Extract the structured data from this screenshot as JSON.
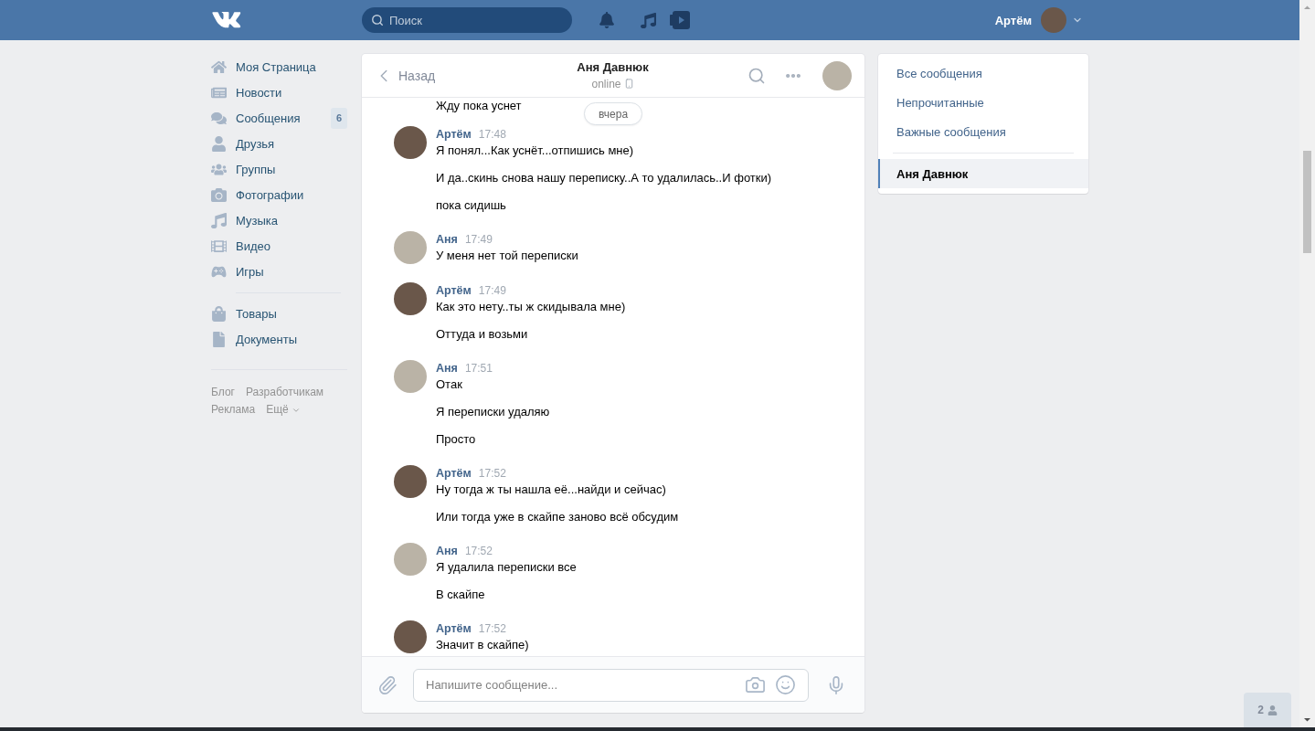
{
  "header": {
    "search": {
      "placeholder": "Поиск"
    },
    "user": {
      "name": "Артём"
    }
  },
  "sidebar": {
    "sections": [
      {
        "items": [
          {
            "label": "Моя Страница"
          },
          {
            "label": "Новости"
          },
          {
            "label": "Сообщения",
            "badge": "6"
          },
          {
            "label": "Друзья"
          },
          {
            "label": "Группы"
          },
          {
            "label": "Фотографии"
          },
          {
            "label": "Музыка"
          },
          {
            "label": "Видео"
          },
          {
            "label": "Игры"
          }
        ]
      },
      {
        "items": [
          {
            "label": "Товары"
          },
          {
            "label": "Документы"
          }
        ]
      }
    ],
    "footer_links": [
      {
        "label": "Блог",
        "dropdown": false
      },
      {
        "label": "Разработчикам",
        "dropdown": false
      },
      {
        "label": "Реклама",
        "dropdown": false
      },
      {
        "label": "Ещё",
        "dropdown": true
      }
    ]
  },
  "chat": {
    "back": "Назад",
    "title": "Аня Давнюк",
    "status": "online",
    "date_divider": "вчера",
    "cut_top_line": "Жду пока уснет",
    "groups": [
      {
        "author": "Артём",
        "from_me": true,
        "time": "17:48",
        "lines": [
          "Я понял...Как уснёт...отпишись мне)",
          "И да..скинь снова нашу переписку..А то удалилась..И фотки)",
          "пока сидишь"
        ]
      },
      {
        "author": "Аня",
        "from_me": false,
        "time": "17:49",
        "lines": [
          "У меня нет той переписки"
        ]
      },
      {
        "author": "Артём",
        "from_me": true,
        "time": "17:49",
        "lines": [
          "Как это нету..ты ж скидывала мне)",
          "Оттуда и возьми"
        ]
      },
      {
        "author": "Аня",
        "from_me": false,
        "time": "17:51",
        "lines": [
          "Отак",
          "Я переписки удаляю",
          "Просто"
        ]
      },
      {
        "author": "Артём",
        "from_me": true,
        "time": "17:52",
        "lines": [
          "Ну тогда ж ты нашла её...найди и сейчас)",
          "Или тогда уже в скайпе заново всё обсудим"
        ]
      },
      {
        "author": "Аня",
        "from_me": false,
        "time": "17:52",
        "lines": [
          "Я удалила переписки все",
          "В скайпе"
        ]
      },
      {
        "author": "Артём",
        "from_me": true,
        "time": "17:52",
        "lines": [
          "Значит в скайпе)"
        ]
      }
    ],
    "composer": {
      "placeholder": "Напишите сообщение..."
    }
  },
  "right_panel": {
    "filters": [
      {
        "label": "Все сообщения",
        "selected": false
      },
      {
        "label": "Непрочитанные",
        "selected": false
      },
      {
        "label": "Важные сообщения",
        "selected": false
      }
    ],
    "conversations": [
      {
        "label": "Аня Давнюк",
        "selected": true
      }
    ]
  },
  "friends_online": {
    "count": "2"
  }
}
